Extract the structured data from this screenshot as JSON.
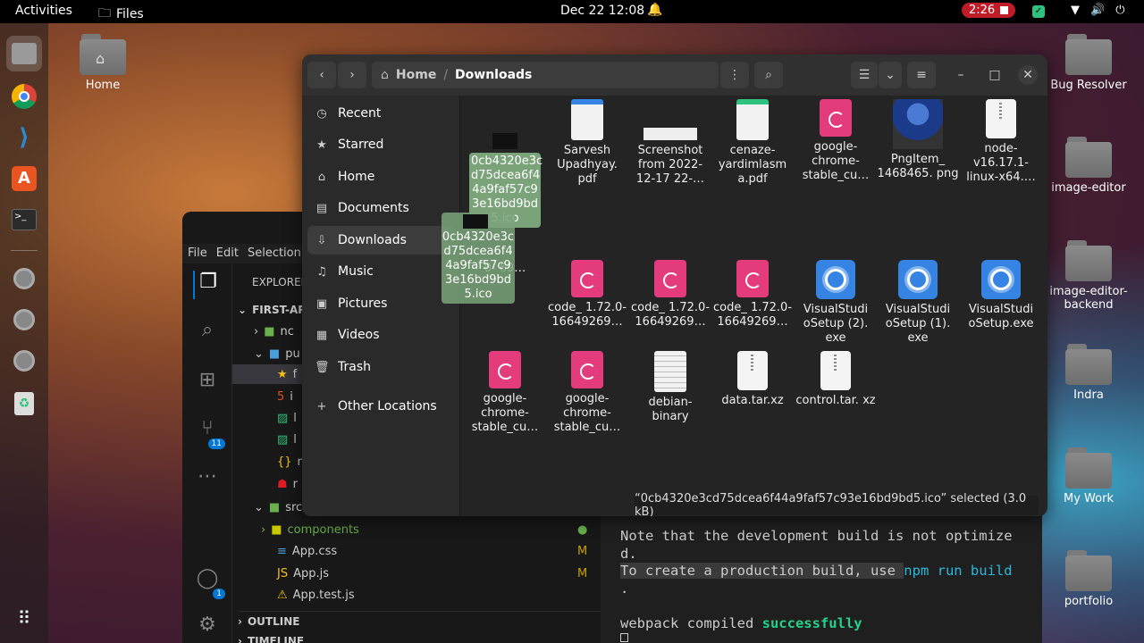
{
  "topbar": {
    "activities": "Activities",
    "files": "Files",
    "clock": "Dec 22  12:08",
    "recording": "2:26"
  },
  "desktop": {
    "icons": [
      "Home",
      "Bug Resolver",
      "image-editor",
      "image-editor-backend",
      "Indra",
      "My Work",
      "portfolio"
    ]
  },
  "vscode": {
    "menu": [
      "File",
      "Edit",
      "Selection"
    ],
    "explorer_label": "EXPLORER",
    "project": "FIRST-APP",
    "tree": [
      "nc",
      "pu",
      "f",
      "i",
      "l",
      "l",
      "n",
      "r",
      "src",
      "components",
      "App.css",
      "App.js",
      "App.test.js"
    ],
    "modified": "M",
    "outline": "OUTLINE",
    "timeline": "TIMELINE",
    "scm_badge": "11",
    "account_badge": "1",
    "terminal": {
      "line1": "Note that the development build is not optimize",
      "line2": "d.",
      "line3a": "To create a production build, use ",
      "line3b": "npm run build",
      "line4": ".",
      "line5a": "webpack compiled ",
      "line5b": "successfully"
    }
  },
  "nautilus": {
    "path_home": "Home",
    "path_sep": "/",
    "path_current": "Downloads",
    "sidebar": [
      "Recent",
      "Starred",
      "Home",
      "Documents",
      "Downloads",
      "Music",
      "Pictures",
      "Videos",
      "Trash",
      "Other Locations"
    ],
    "files": [
      {
        "name": "0cb4320e3c d75dcea6f4 4a9faf57c9 3e16bd9bd 5.ico",
        "type": "ico"
      },
      {
        "name": "Sarvesh Upadhyay. pdf",
        "type": "doc"
      },
      {
        "name": "Screenshot from 2022- 12-17 22-…",
        "type": "shot"
      },
      {
        "name": "cenaze- yardimlasm a.pdf",
        "type": "doc"
      },
      {
        "name": "google- chrome- stable_cu…",
        "type": "deb"
      },
      {
        "name": "PngItem_ 1468465. png",
        "type": "png"
      },
      {
        "name": "node- v16.17.1- linux-x64.…",
        "type": "zip"
      },
      {
        "name": "0- 69…",
        "type": "deb"
      },
      {
        "name": "code_ 1.72.0- 16649269…",
        "type": "deb"
      },
      {
        "name": "code_ 1.72.0- 16649269…",
        "type": "deb"
      },
      {
        "name": "code_ 1.72.0- 16649269…",
        "type": "deb"
      },
      {
        "name": "VisualStudi oSetup (2). exe",
        "type": "exe"
      },
      {
        "name": "VisualStudi oSetup (1). exe",
        "type": "exe"
      },
      {
        "name": "VisualStudi oSetup.exe",
        "type": "exe"
      },
      {
        "name": "google- chrome- stable_cu…",
        "type": "deb"
      },
      {
        "name": "google- chrome- stable_cu…",
        "type": "deb"
      },
      {
        "name": "debian- binary",
        "type": "txt"
      },
      {
        "name": "data.tar.xz",
        "type": "zip"
      },
      {
        "name": "control.tar. xz",
        "type": "zip"
      }
    ],
    "drag_label": "0cb4320e3c d75dcea6f4 4a9faf57c9 3e16bd9bd 5.ico",
    "status": "“0cb4320e3cd75dcea6f44a9faf57c93e16bd9bd5.ico” selected  (3.0 kB)"
  }
}
